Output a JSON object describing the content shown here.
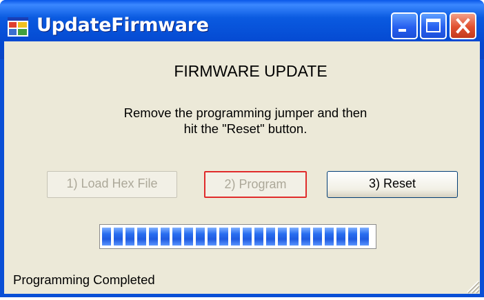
{
  "window": {
    "title": "UpdateFirmware",
    "icon": "app-window-icon",
    "controls": [
      "minimize-icon",
      "maximize-icon",
      "close-icon"
    ]
  },
  "content": {
    "heading": "FIRMWARE UPDATE",
    "message_line1": "Remove the programming jumper and then",
    "message_line2": "hit the \"Reset\" button."
  },
  "buttons": {
    "load": {
      "label": "1) Load Hex File",
      "enabled": false
    },
    "program": {
      "label": "2) Program",
      "enabled": false
    },
    "reset": {
      "label": "3) Reset",
      "enabled": true
    }
  },
  "progress": {
    "value": 1.0
  },
  "status": {
    "text": "Programming Completed"
  },
  "colors": {
    "titlebar": "#0a58e8",
    "client": "#ece9d8",
    "progress": "#2a6ef0",
    "close": "#e0502f",
    "focus_border": "#e02a2a"
  }
}
